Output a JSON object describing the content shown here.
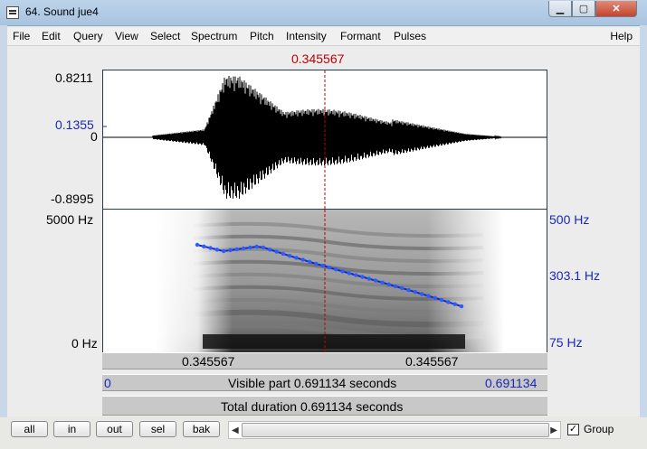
{
  "window": {
    "title": "64. Sound jue4"
  },
  "menu": [
    "File",
    "Edit",
    "Query",
    "View",
    "Select",
    "Spectrum",
    "Pitch",
    "Intensity",
    "Formant",
    "Pulses"
  ],
  "help": "Help",
  "cursor_time": "0.345567",
  "waveform": {
    "max": "0.8211",
    "cursor_value": "0.1355",
    "zero": "0",
    "min": "-0.8995"
  },
  "spectrogram": {
    "freq_top": "5000 Hz",
    "freq_bottom": "0 Hz",
    "pitch_top": "500 Hz",
    "pitch_mid": "303.1 Hz",
    "pitch_bottom": "75 Hz"
  },
  "time_bar": {
    "left": "0.345567",
    "right": "0.345567"
  },
  "visible_bar": {
    "start": "0",
    "label": "Visible part 0.691134 seconds",
    "end": "0.691134"
  },
  "total_bar": {
    "label": "Total duration 0.691134 seconds"
  },
  "buttons": {
    "all": "all",
    "in": "in",
    "out": "out",
    "sel": "sel",
    "bak": "bak"
  },
  "group": {
    "label": "Group",
    "checked": true
  },
  "colors": {
    "cursor": "#c00000",
    "pitch": "#1a28b8",
    "pitch_point": "#2a5cff"
  }
}
